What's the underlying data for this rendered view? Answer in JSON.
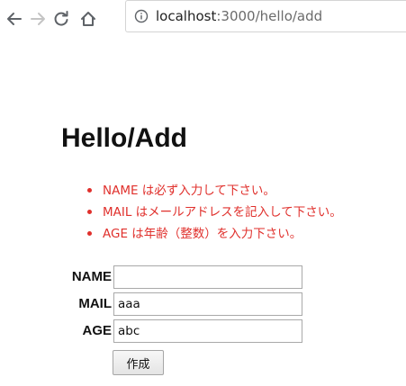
{
  "browser": {
    "url_host": "localhost",
    "url_path": ":3000/hello/add"
  },
  "page": {
    "title": "Hello/Add",
    "errors": [
      "NAME は必ず入力して下さい。",
      "MAIL はメールアドレスを記入して下さい。",
      "AGE は年齢（整数）を入力下さい。"
    ],
    "error_color": "#e0302c"
  },
  "form": {
    "name_label": "NAME",
    "name_value": "",
    "mail_label": "MAIL",
    "mail_value": "aaa",
    "age_label": "AGE",
    "age_value": "abc",
    "submit_label": "作成"
  }
}
